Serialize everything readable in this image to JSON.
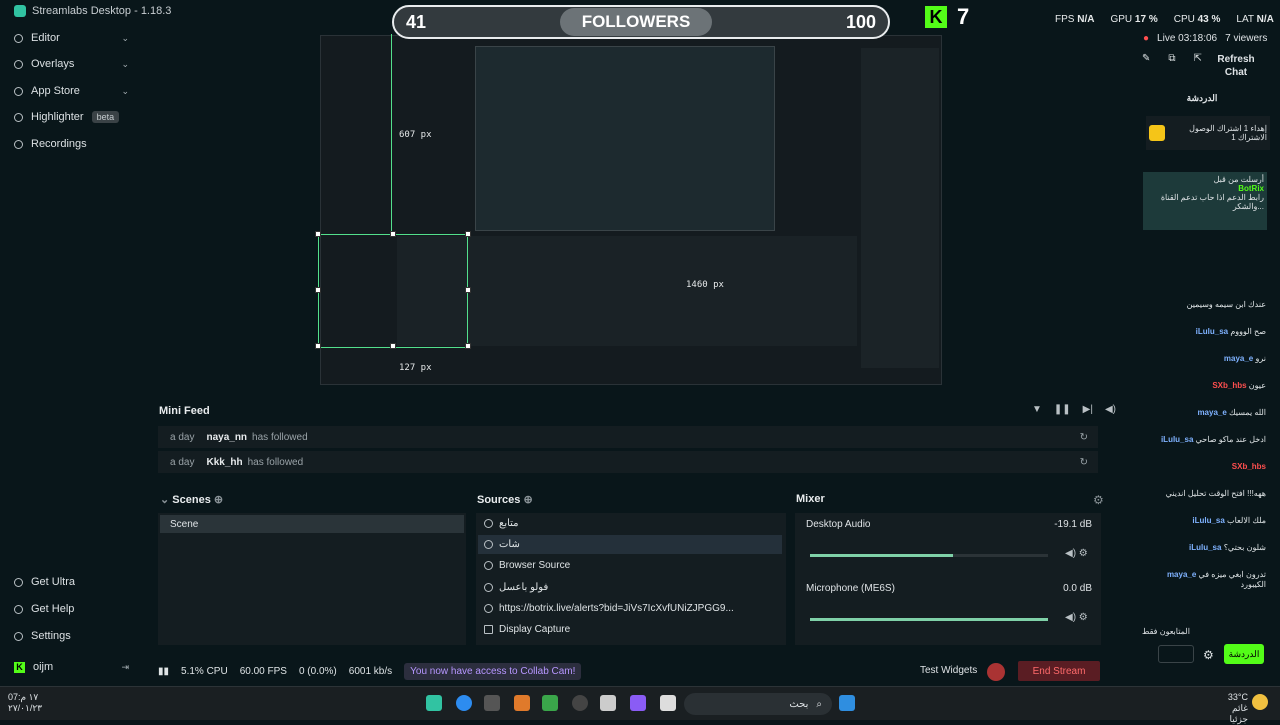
{
  "titlebar": {
    "app_title": "Streamlabs Desktop - 1.18.3"
  },
  "overlay": {
    "left_count": "41",
    "label": "FOLLOWERS",
    "right_count": "100",
    "kick_letter": "K",
    "kick_count": "7"
  },
  "stats": {
    "fps_label": "FPS",
    "fps_value": "N/A",
    "gpu_label": "GPU",
    "gpu_value": "17 %",
    "cpu_label": "CPU",
    "cpu_value": "43 %",
    "lat_label": "LAT",
    "lat_value": "N/A"
  },
  "sidebar": {
    "items": [
      {
        "label": "Editor"
      },
      {
        "label": "Overlays"
      },
      {
        "label": "App Store"
      },
      {
        "label": "Highlighter",
        "badge": "beta"
      },
      {
        "label": "Recordings"
      }
    ],
    "bottom": [
      {
        "label": "Get Ultra"
      },
      {
        "label": "Get Help"
      },
      {
        "label": "Settings"
      }
    ],
    "user": "oijm"
  },
  "preview": {
    "dim_w": "607 px",
    "dim_h": "1460 px",
    "dim_s": "127 px"
  },
  "minifeed": {
    "title": "Mini Feed",
    "rows": [
      {
        "time": "a day",
        "user": "naya_nn",
        "action": "has followed"
      },
      {
        "time": "a day",
        "user": "Kkk_hh",
        "action": "has followed"
      }
    ]
  },
  "scenes": {
    "title": "Scenes",
    "items": [
      "Scene"
    ]
  },
  "sources": {
    "title": "Sources",
    "items": [
      "متابع",
      "شات",
      "Browser Source",
      "فولو باعسل",
      "https://botrix.live/alerts?bid=JiVs7IcXvfUNiZJPGG9...",
      "Display Capture"
    ]
  },
  "mixer": {
    "title": "Mixer",
    "tracks": [
      {
        "name": "Desktop Audio",
        "db": "-19.1 dB",
        "level": 0.6
      },
      {
        "name": "Microphone (ME6S)",
        "db": "0.0 dB",
        "level": 1.0
      }
    ]
  },
  "status": {
    "cpu": "5.1% CPU",
    "fps": "60.00 FPS",
    "dropped": "0 (0.0%)",
    "bitrate": "6001 kb/s",
    "collab": "You now have access to Collab Cam!",
    "test_widgets": "Test Widgets",
    "end_stream": "End Stream"
  },
  "chat": {
    "live": "Live 03:18:06",
    "viewers": "7 viewers",
    "refresh": "Refresh Chat",
    "header": "الدردشة",
    "pinned_goal": "إهداء 1 اشتراك الوصول الاشتراك 1",
    "pinned_by": "أرسلت من قبل",
    "bot": "BotRix",
    "bot_msg": "رابط الدعم اذا حاب تدعم القناة والشكر...",
    "send": "الدردشة",
    "footer": "المتابعون فقط"
  },
  "chat_lines": [
    {
      "user": "",
      "text": "عندك ابن سيمه وسيمين"
    },
    {
      "user": "iLulu_sa",
      "text": "صح الوووم"
    },
    {
      "user": "maya_e",
      "text": "نرو"
    },
    {
      "user": "SXb_hbs",
      "text": "عيون",
      "red": true
    },
    {
      "user": "maya_e",
      "text": "الله يمسيك"
    },
    {
      "user": "iLulu_sa",
      "text": "ادخل عند ماكو صاحي"
    },
    {
      "user": "SXb_hbs",
      "text": "",
      "red": true
    },
    {
      "user": "",
      "text": "ههه!!! افتح الوقت تحليل انديني"
    },
    {
      "user": "iLulu_sa",
      "text": "ملك الالعاب"
    },
    {
      "user": "iLulu_sa",
      "text": "شلون بحتي؟"
    },
    {
      "user": "maya_e",
      "text": "تدرون ابغي ميزه في الكيبورد"
    }
  ],
  "taskbar": {
    "search": "بحث",
    "time": "07:١٧ م",
    "date": "٢٧/٠١/٢٣",
    "weather": "33°C",
    "weather_desc": "غائم جزئيا"
  },
  "colors": {
    "accent": "#31c3a2",
    "kick": "#53fc18",
    "end_stream": "#ff6b6b",
    "collab": "#b696ff"
  }
}
